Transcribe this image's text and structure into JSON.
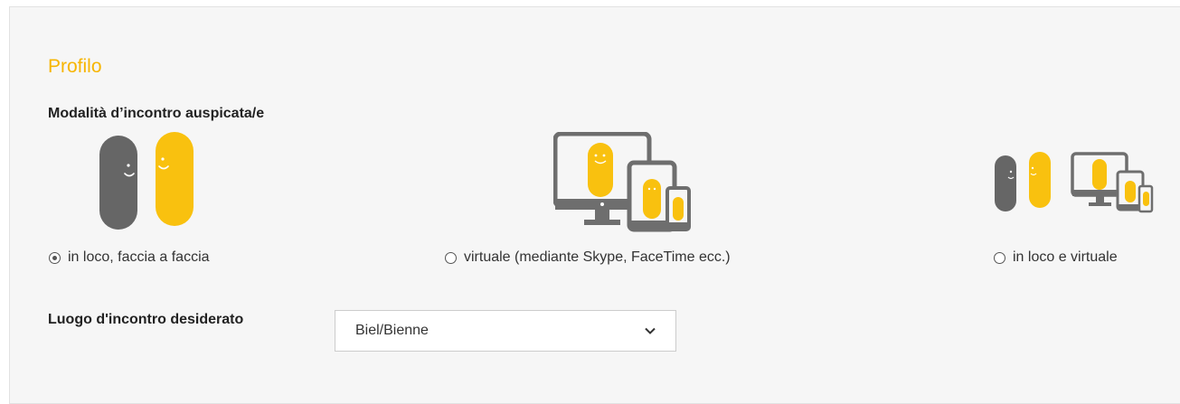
{
  "section": {
    "title": "Profilo"
  },
  "meeting_mode": {
    "label": "Modalità d’incontro auspicata/e",
    "options": [
      {
        "label": "in loco, faccia a faccia",
        "checked": true,
        "icon": "two-people-icon"
      },
      {
        "label": "virtuale (mediante Skype, FaceTime ecc.)",
        "checked": false,
        "icon": "devices-icon"
      },
      {
        "label": "in loco e virtuale",
        "checked": false,
        "icon": "people-and-devices-icon"
      }
    ]
  },
  "location": {
    "label": "Luogo d'incontro desiderato",
    "selected": "Biel/Bienne"
  },
  "colors": {
    "accent": "#f7b500",
    "dark_figure": "#666666",
    "device": "#6e6e6e"
  }
}
